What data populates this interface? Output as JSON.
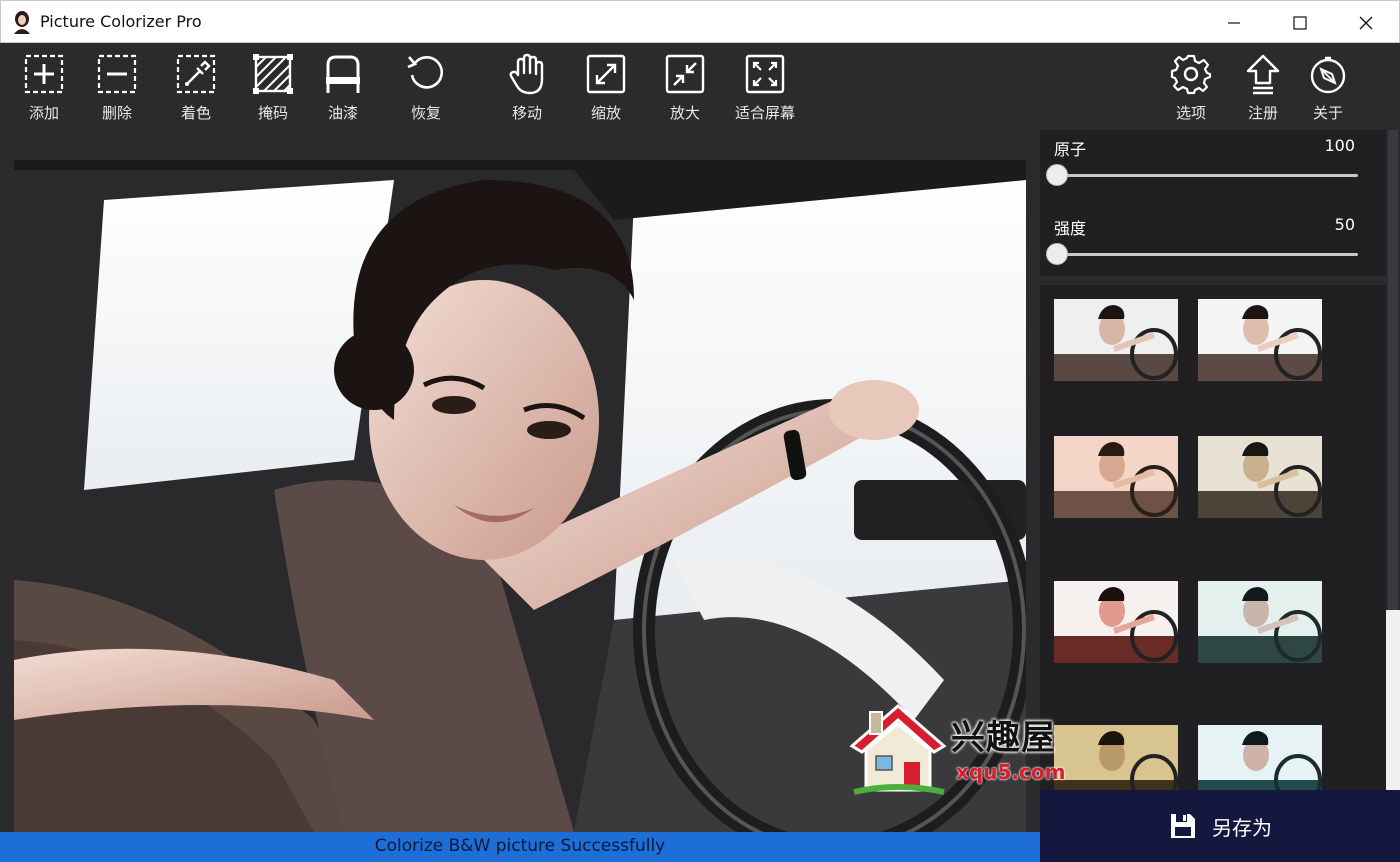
{
  "window": {
    "title": "Picture Colorizer Pro"
  },
  "toolbar": {
    "add": "添加",
    "delete": "删除",
    "colorize": "着色",
    "mask": "掩码",
    "paint": "油漆",
    "restore": "恢复",
    "move": "移动",
    "zoom": "缩放",
    "enlarge": "放大",
    "fit_screen": "适合屏幕",
    "options": "选项",
    "register": "注册",
    "about": "关于"
  },
  "sliders": [
    {
      "label": "原子",
      "value": "100",
      "fraction": 0.0
    },
    {
      "label": "强度",
      "value": "50",
      "fraction": 0.0
    }
  ],
  "save_button": {
    "label": "另存为"
  },
  "status": {
    "text": "Colorize B&W picture Successfully"
  },
  "watermark": {
    "text": "兴趣屋",
    "url": "xqu5.com"
  },
  "icons": [
    "add-icon",
    "delete-icon",
    "colorize-icon",
    "mask-icon",
    "paint-icon",
    "restore-icon",
    "hand-icon",
    "zoom-icon",
    "enlarge-icon",
    "fit-screen-icon",
    "gear-icon",
    "register-icon",
    "compass-icon",
    "save-icon"
  ]
}
